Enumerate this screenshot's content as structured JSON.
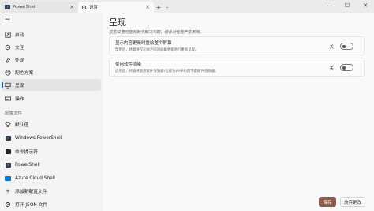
{
  "titlebar": {
    "tabs": [
      {
        "label": "PowerShell",
        "icon": "powershell-icon",
        "active": false
      },
      {
        "label": "设置",
        "icon": "gear-icon",
        "active": true
      }
    ],
    "new_tab": "+",
    "dropdown": "⌄",
    "window_controls": {
      "minimize": "—",
      "maximize": "☐",
      "close": "✕"
    }
  },
  "sidebar": {
    "menu_icon": "☰",
    "items": [
      {
        "label": "启动",
        "icon": "launch-icon"
      },
      {
        "label": "交互",
        "icon": "interaction-icon"
      },
      {
        "label": "外观",
        "icon": "paint-icon"
      },
      {
        "label": "配色方案",
        "icon": "color-palette-icon"
      },
      {
        "label": "呈现",
        "icon": "monitor-icon",
        "selected": true
      },
      {
        "label": "操作",
        "icon": "keyboard-icon"
      }
    ],
    "profiles_header": "配置文件",
    "profiles": [
      {
        "label": "默认值",
        "icon": "layers-icon"
      },
      {
        "label": "Windows PowerShell",
        "icon": "powershell-icon"
      },
      {
        "label": "命令提示符",
        "icon": "cmd-icon"
      },
      {
        "label": "PowerShell",
        "icon": "powershell-icon"
      },
      {
        "label": "Azure Cloud Shell",
        "icon": "azure-icon"
      },
      {
        "label": "添加新配置文件",
        "icon": "plus-icon"
      }
    ],
    "open_json": {
      "label": "打开 JSON 文件",
      "icon": "gear-icon"
    }
  },
  "main": {
    "title": "呈现",
    "description": "这些设置可能有助于解决问题，但会对性能产生影响。",
    "settings": [
      {
        "title": "显示内容更新时重绘整个屏幕",
        "description": "禁用后，终端将仅在帧之间对屏幕更新进行重新呈现。",
        "state_label": "关",
        "enabled": false
      },
      {
        "title": "使用软件渲染",
        "description": "启用后，终端将使用软件渲染器(也称为WARP)而不是硬件渲染器。",
        "state_label": "关",
        "enabled": false
      }
    ],
    "save_label": "保存",
    "discard_label": "放弃更改",
    "accent_color": "#8c5b4d",
    "selection_indicator_color": "#005fb8"
  }
}
